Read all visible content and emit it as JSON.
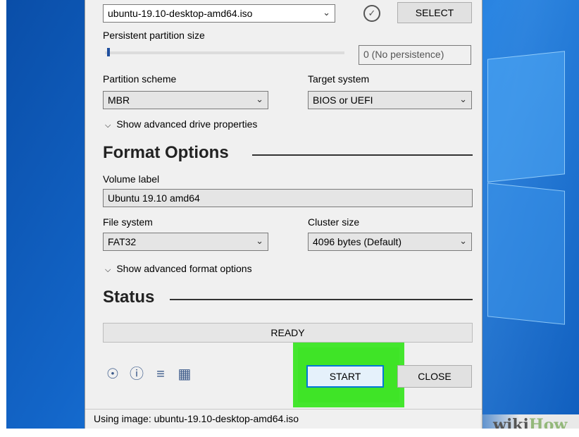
{
  "device": {
    "iso_value": "ubuntu-19.10-desktop-amd64.iso",
    "select_label": "SELECT",
    "persistent_label": "Persistent partition size",
    "persistence_value": "0 (No persistence)",
    "partition_scheme_label": "Partition scheme",
    "partition_scheme_value": "MBR",
    "target_system_label": "Target system",
    "target_system_value": "BIOS or UEFI",
    "advanced_drive_label": "Show advanced drive properties"
  },
  "format": {
    "title": "Format Options",
    "volume_label_label": "Volume label",
    "volume_label_value": "Ubuntu 19.10 amd64",
    "file_system_label": "File system",
    "file_system_value": "FAT32",
    "cluster_size_label": "Cluster size",
    "cluster_size_value": "4096 bytes (Default)",
    "advanced_format_label": "Show advanced format options"
  },
  "status": {
    "title": "Status",
    "progress_text": "READY",
    "progress_fraction": 0
  },
  "actions": {
    "start_label": "START",
    "close_label": "CLOSE",
    "icons": [
      "globe-icon",
      "info-icon",
      "settings-sliders-icon",
      "log-icon"
    ]
  },
  "statusbar": {
    "text": "Using image: ubuntu-19.10-desktop-amd64.iso"
  },
  "watermark": {
    "brand_a": "wiki",
    "brand_b": "How"
  },
  "colors": {
    "highlight": "#44e62e",
    "desktop_blue": "#1366c9"
  }
}
